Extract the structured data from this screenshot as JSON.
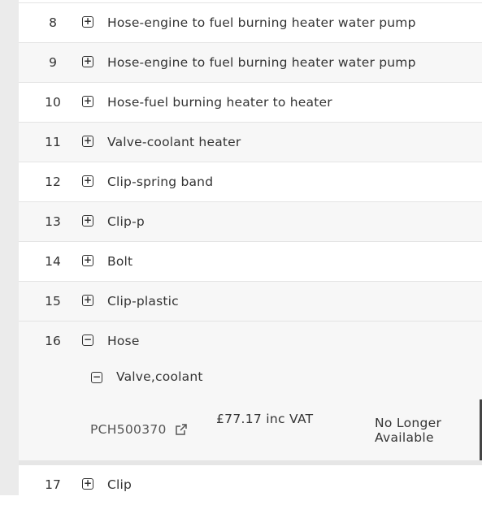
{
  "rows": [
    {
      "num": "8",
      "icon": "plus",
      "label": "Hose-engine to fuel burning heater water pump"
    },
    {
      "num": "9",
      "icon": "plus",
      "label": "Hose-engine to fuel burning heater water pump"
    },
    {
      "num": "10",
      "icon": "plus",
      "label": "Hose-fuel burning heater to heater"
    },
    {
      "num": "11",
      "icon": "plus",
      "label": "Valve-coolant heater"
    },
    {
      "num": "12",
      "icon": "plus",
      "label": "Clip-spring band"
    },
    {
      "num": "13",
      "icon": "plus",
      "label": "Clip-p"
    },
    {
      "num": "14",
      "icon": "plus",
      "label": "Bolt"
    },
    {
      "num": "15",
      "icon": "plus",
      "label": "Clip-plastic"
    },
    {
      "num": "16",
      "icon": "minus",
      "label": "Hose"
    }
  ],
  "expanded": {
    "sub_label": "Valve,coolant",
    "part_number": "PCH500370",
    "price": "£77.17 inc VAT",
    "availability": "No Longer Available"
  },
  "last_row": {
    "num": "17",
    "icon": "plus",
    "label": "Clip"
  },
  "colors": {
    "row_alt": "#f7f7f7",
    "left_bar": "#ebebeb",
    "text": "#333333"
  }
}
